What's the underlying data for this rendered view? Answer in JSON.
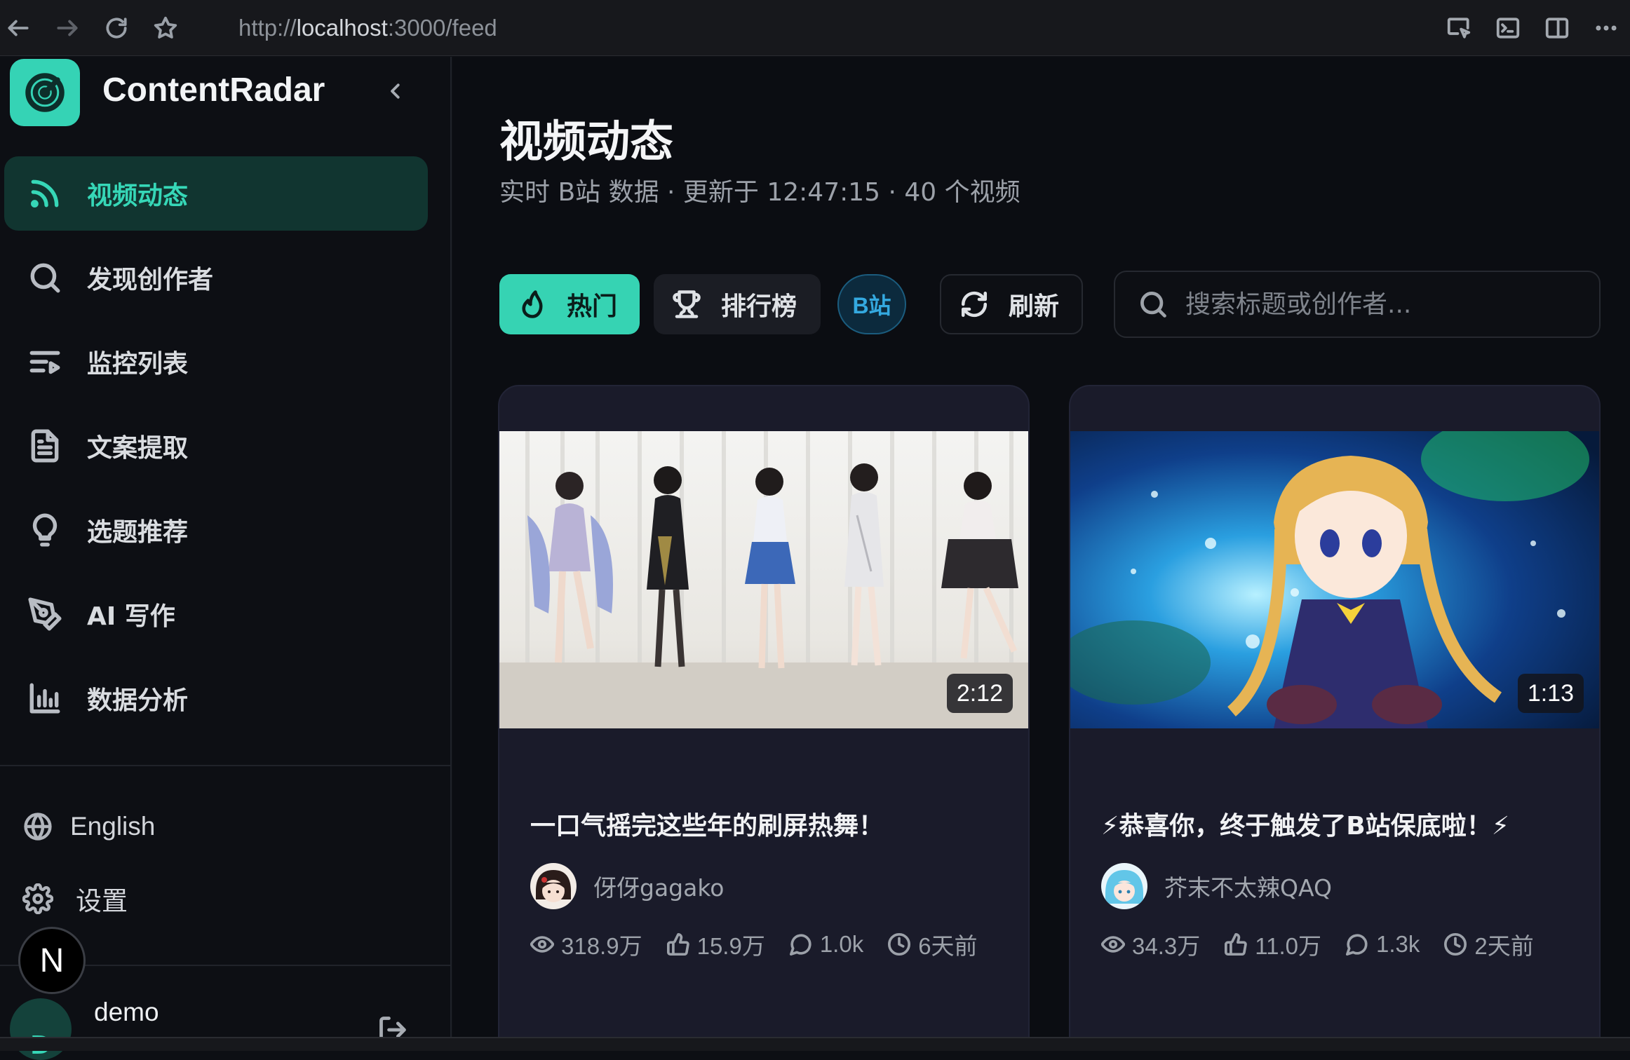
{
  "browser": {
    "url_prefix": "http://",
    "url_host": "localhost",
    "url_rest": ":3000/feed"
  },
  "sidebar": {
    "brand": "ContentRadar",
    "items": [
      {
        "label": "视频动态",
        "icon": "rss-icon",
        "active": true
      },
      {
        "label": "发现创作者",
        "icon": "search-icon",
        "active": false
      },
      {
        "label": "监控列表",
        "icon": "playlist-icon",
        "active": false
      },
      {
        "label": "文案提取",
        "icon": "document-icon",
        "active": false
      },
      {
        "label": "选题推荐",
        "icon": "lightbulb-icon",
        "active": false
      },
      {
        "label": "AI 写作",
        "icon": "pen-tool-icon",
        "active": false
      },
      {
        "label": "数据分析",
        "icon": "bar-chart-icon",
        "active": false
      }
    ],
    "language": "English",
    "settings": "设置",
    "next_badge": "N",
    "user": {
      "initial": "D",
      "name": "demo"
    }
  },
  "main": {
    "title": "视频动态",
    "subtitle": "实时 B站 数据 · 更新于 12:47:15 · 40 个视频",
    "toolbar": {
      "hot": "热门",
      "ranking": "排行榜",
      "platform": "B站",
      "refresh": "刷新",
      "search_placeholder": "搜索标题或创作者..."
    },
    "videos": [
      {
        "title": "一口气摇完这些年的刷屏热舞！",
        "duration": "2:12",
        "author": "伢伢gagako",
        "views": "318.9万",
        "likes": "15.9万",
        "comments": "1.0k",
        "time": "6天前"
      },
      {
        "title": "⚡恭喜你，终于触发了B站保底啦！⚡",
        "duration": "1:13",
        "author": "芥末不太辣QAQ",
        "views": "34.3万",
        "likes": "11.0万",
        "comments": "1.3k",
        "time": "2天前"
      }
    ]
  },
  "colors": {
    "accent": "#36d3b3",
    "bili_blue": "#34a9e0",
    "background": "#0b0d12",
    "card": "#1a1b2a"
  }
}
